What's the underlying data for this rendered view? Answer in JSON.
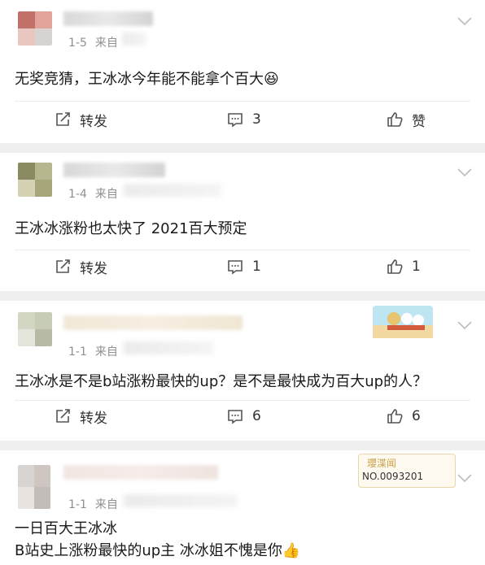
{
  "comments": [
    {
      "date": "1-5",
      "source_prefix": "来自",
      "text": "无奖竞猜，王冰冰今年能不能拿个百大😆",
      "actions": {
        "repost": "转发",
        "comment_count": "3",
        "like": "赞"
      },
      "avatar_colors": [
        "#c2706a",
        "#e2a39a",
        "#e8c7c0",
        "#d7d3d0"
      ]
    },
    {
      "date": "1-4",
      "source_prefix": "来自",
      "text": "王冰冰涨粉也太快了 2021百大预定",
      "actions": {
        "repost": "转发",
        "comment_count": "1",
        "like_count": "1"
      },
      "avatar_colors": [
        "#8a8a63",
        "#b7b78f",
        "#d4d2b3",
        "#a6a67a"
      ]
    },
    {
      "date": "1-1",
      "source_prefix": "来自",
      "text": "王冰冰是不是b站涨粉最快的up？是不是最快成为百大up的人？",
      "actions": {
        "repost": "转发",
        "comment_count": "6",
        "like_count": "6"
      },
      "avatar_colors": [
        "#d2d7c3",
        "#c7ccb6",
        "#e4e5db",
        "#b7bba6"
      ]
    },
    {
      "date": "1-1",
      "source_prefix": "来自",
      "text_lines": [
        "一日百大王冰冰",
        "B站史上涨粉最快的up主 冰冰姐不愧是你👍"
      ],
      "badge": {
        "title": "瓔渫闻",
        "number": "NO.0093201"
      },
      "avatar_colors": [
        "#d8d4d2",
        "#cfc6c2",
        "#e8e4e2",
        "#c2bdb9"
      ]
    }
  ]
}
